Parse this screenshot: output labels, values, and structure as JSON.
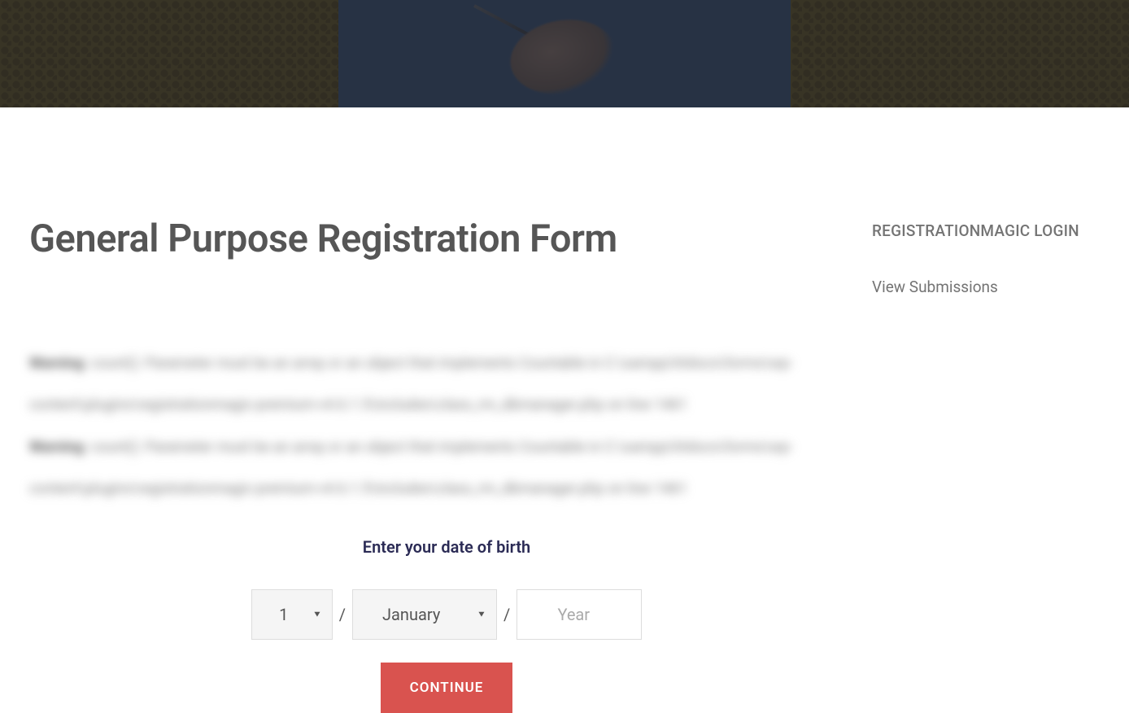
{
  "page": {
    "title": "General Purpose Registration Form"
  },
  "warnings": [
    {
      "prefix": "Warning",
      "msg": ": count(): Parameter must be an array or an object that implements Countable in C:\\xampp\\htdocs\\forms\\wp-content\\plugins\\registrationmagic-premium-v4.6.1.5\\includes\\class_rm_dbmanager.php on line 1461"
    },
    {
      "prefix": "Warning",
      "msg": ": count(): Parameter must be an array or an object that implements Countable in C:\\xampp\\htdocs\\forms\\wp-content\\plugins\\registrationmagic-premium-v4.6.1.5\\includes\\class_rm_dbmanager.php on line 1461"
    }
  ],
  "dob": {
    "label": "Enter your date of birth",
    "day_value": "1",
    "month_value": "January",
    "year_placeholder": "Year",
    "separator": "/",
    "continue_label": "CONTINUE"
  },
  "sidebar": {
    "heading": "REGISTRATIONMAGIC LOGIN",
    "link": "View Submissions"
  }
}
